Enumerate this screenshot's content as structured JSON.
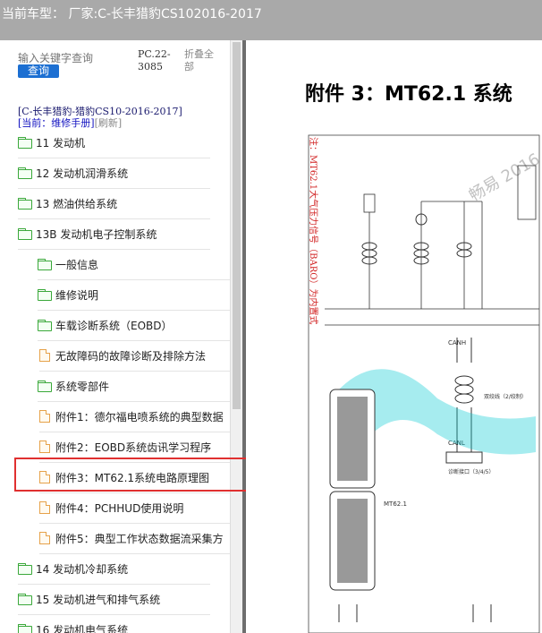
{
  "titlebar": {
    "text": "当前车型： 厂家:C-长丰猎豹CS102016-2017"
  },
  "search": {
    "placeholder": "输入关键字查询",
    "button_label": "查询"
  },
  "pc_code": "PC.22-3085",
  "collapse_label": "折叠全部",
  "breadcrumb": "[C-长丰猎豹-猎豹CS10-2016-2017]",
  "current": {
    "label": "[当前：维修手册]",
    "refresh": "[刷新]"
  },
  "tree": [
    {
      "label": "11 发动机",
      "icon": "folder-icon",
      "level": 0
    },
    {
      "label": "12 发动机润滑系统",
      "icon": "folder-icon",
      "level": 0
    },
    {
      "label": "13 燃油供给系统",
      "icon": "folder-icon",
      "level": 0
    },
    {
      "label": "13B 发动机电子控制系统",
      "icon": "folder-icon",
      "level": 0
    },
    {
      "label": "一般信息",
      "icon": "folder-icon",
      "level": 1
    },
    {
      "label": "维修说明",
      "icon": "folder-icon",
      "level": 1
    },
    {
      "label": "车载诊断系统（EOBD）",
      "icon": "folder-icon",
      "level": 1
    },
    {
      "label": "无故障码的故障诊断及排除方法",
      "icon": "document-icon",
      "level": 1
    },
    {
      "label": "系统零部件",
      "icon": "folder-icon",
      "level": 1
    },
    {
      "label": "附件1：德尔福电喷系统的典型数据",
      "icon": "document-icon",
      "level": 1
    },
    {
      "label": "附件2：EOBD系统齿讯学习程序",
      "icon": "document-icon",
      "level": 1
    },
    {
      "label": "附件3：MT62.1系统电路原理图",
      "icon": "document-icon",
      "level": 1
    },
    {
      "label": "附件4：PCHHUD使用说明",
      "icon": "document-icon",
      "level": 1
    },
    {
      "label": "附件5：典型工作状态数据流采集方",
      "icon": "document-icon",
      "level": 1
    },
    {
      "label": "14 发动机冷却系统",
      "icon": "folder-icon",
      "level": 0
    },
    {
      "label": "15 发动机进气和排气系统",
      "icon": "folder-icon",
      "level": 0
    },
    {
      "label": "16 发动机电气系统",
      "icon": "folder-icon",
      "level": 0
    }
  ],
  "document": {
    "title": "附件 3：MT62.1 系统",
    "note": "注：MT62.1大气压力信号（BARO）为内置式",
    "watermark": "畅易 2016",
    "labels": [
      "CANH",
      "CANL",
      "双绞线（2/绞制）",
      "诊断接口（3/4/5）",
      "MT62.1"
    ],
    "accent": "#00c8d0",
    "note_color": "#d02020"
  }
}
